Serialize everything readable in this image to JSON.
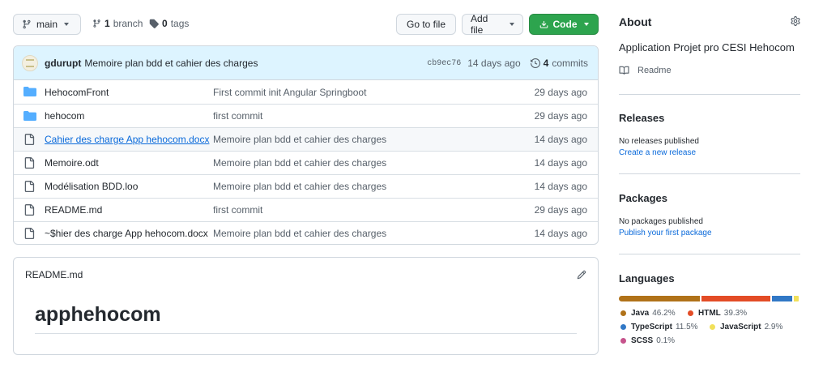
{
  "toolbar": {
    "branch_label": "main",
    "branches_count": "1",
    "branches_label": "branch",
    "tags_count": "0",
    "tags_label": "tags",
    "goto_file_label": "Go to file",
    "add_file_label": "Add file",
    "code_label": "Code"
  },
  "commit": {
    "author": "gdurupt",
    "message": "Memoire plan bdd et cahier des charges",
    "hash": "cb9ec76",
    "age": "14 days ago",
    "commits_count": "4",
    "commits_label": "commits"
  },
  "files": [
    {
      "type": "dir",
      "name": "HehocomFront",
      "message": "First commit init Angular Springboot",
      "age": "29 days ago"
    },
    {
      "type": "dir",
      "name": "hehocom",
      "message": "first commit",
      "age": "29 days ago"
    },
    {
      "type": "file",
      "name": "Cahier des charge App hehocom.docx",
      "message": "Memoire plan bdd et cahier des charges",
      "age": "14 days ago"
    },
    {
      "type": "file",
      "name": "Memoire.odt",
      "message": "Memoire plan bdd et cahier des charges",
      "age": "14 days ago"
    },
    {
      "type": "file",
      "name": "Modélisation BDD.loo",
      "message": "Memoire plan bdd et cahier des charges",
      "age": "14 days ago"
    },
    {
      "type": "file",
      "name": "README.md",
      "message": "first commit",
      "age": "29 days ago"
    },
    {
      "type": "file",
      "name": "~$hier des charge App hehocom.docx",
      "message": "Memoire plan bdd et cahier des charges",
      "age": "14 days ago"
    }
  ],
  "readme": {
    "filename": "README.md",
    "heading": "apphehocom"
  },
  "about": {
    "title": "About",
    "description": "Application Projet pro CESI Hehocom",
    "readme_label": "Readme"
  },
  "releases": {
    "title": "Releases",
    "empty_text": "No releases published",
    "create_link": "Create a new release"
  },
  "packages": {
    "title": "Packages",
    "empty_text": "No packages published",
    "publish_link": "Publish your first package"
  },
  "languages": {
    "title": "Languages",
    "items": [
      {
        "name": "Java",
        "percent": "46.2%",
        "value": 46.2,
        "color": "#b07219"
      },
      {
        "name": "HTML",
        "percent": "39.3%",
        "value": 39.3,
        "color": "#e34c26"
      },
      {
        "name": "TypeScript",
        "percent": "11.5%",
        "value": 11.5,
        "color": "#3178c6"
      },
      {
        "name": "JavaScript",
        "percent": "2.9%",
        "value": 2.9,
        "color": "#f1e05a"
      },
      {
        "name": "SCSS",
        "percent": "0.1%",
        "value": 0.1,
        "color": "#c6538c"
      }
    ]
  },
  "colors": {
    "accent_green": "#2da44e",
    "link_blue": "#0969da",
    "folder_blue": "#54aeff"
  }
}
